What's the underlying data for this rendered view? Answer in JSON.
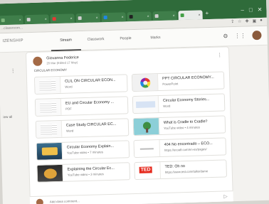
{
  "browser": {
    "tabs": [
      {
        "label": "",
        "fav": "#7fb77e"
      },
      {
        "label": "",
        "fav": "#cfcfcf"
      },
      {
        "label": "",
        "fav": "#e53935"
      },
      {
        "label": "",
        "fav": "#cfcfcf"
      },
      {
        "label": "",
        "fav": "#1e88e5"
      },
      {
        "label": "",
        "fav": "#222222"
      },
      {
        "label": "",
        "fav": "#cfcfcf"
      },
      {
        "label": "",
        "fav": "#43a047"
      }
    ],
    "active_tab_label": "",
    "url": "...classroom...",
    "add_tab": "+",
    "window_controls": [
      "–",
      "□",
      "✕"
    ]
  },
  "app": {
    "course_name": "IZENSHIP",
    "tabs": [
      "Stream",
      "Classwork",
      "People",
      "Marks"
    ],
    "active_tab": "Stream"
  },
  "sidebar": {
    "view_all": "iew all"
  },
  "post": {
    "author": "Giovanna Federice",
    "date": "20 Mar (Edited 17 May)",
    "text": "CIRCULAR ECONOMY",
    "attachments": [
      {
        "title": "CLIL ON CIRCULAR ECON...",
        "subtitle": "Word",
        "thumb": "word"
      },
      {
        "title": "PPT CIRCULAR ECONOMY...",
        "subtitle": "PowerPoint",
        "thumb": "ppt"
      },
      {
        "title": "EU and Circular Economy ...",
        "subtitle": "PDF",
        "thumb": "doc"
      },
      {
        "title": "Circular Economy Stories...",
        "subtitle": "Word",
        "thumb": "word2"
      },
      {
        "title": "Case Study CIRCULAR EC...",
        "subtitle": "Word",
        "thumb": "doc"
      },
      {
        "title": "What is Cradle to Cradle?",
        "subtitle": "YouTube video • 4 minutes",
        "thumb": "tree"
      },
      {
        "title": "Circular Economy Explain...",
        "subtitle": "YouTube video • 7 minutes",
        "thumb": "vid1"
      },
      {
        "title": "404 No encontrado – ECO...",
        "subtitle": "https://ecoalf.com/en-es/pages/",
        "thumb": "404"
      },
      {
        "title": "Explaining the Circular Ec...",
        "subtitle": "YouTube video • 3 minutes",
        "thumb": "vid2"
      },
      {
        "title": "TED: Oh no",
        "subtitle": "https://www.ted.com/talks/dame",
        "thumb": "ted"
      }
    ]
  },
  "comment": {
    "placeholder": "Add class comment..."
  },
  "icons": {
    "apps": "apps-grid-icon",
    "settings": "gear-icon",
    "more": "more-vert-icon",
    "send": "send-icon"
  },
  "colors": {
    "browser_tabbar": "#2f6b3a",
    "ted_red": "#e62b1e"
  }
}
